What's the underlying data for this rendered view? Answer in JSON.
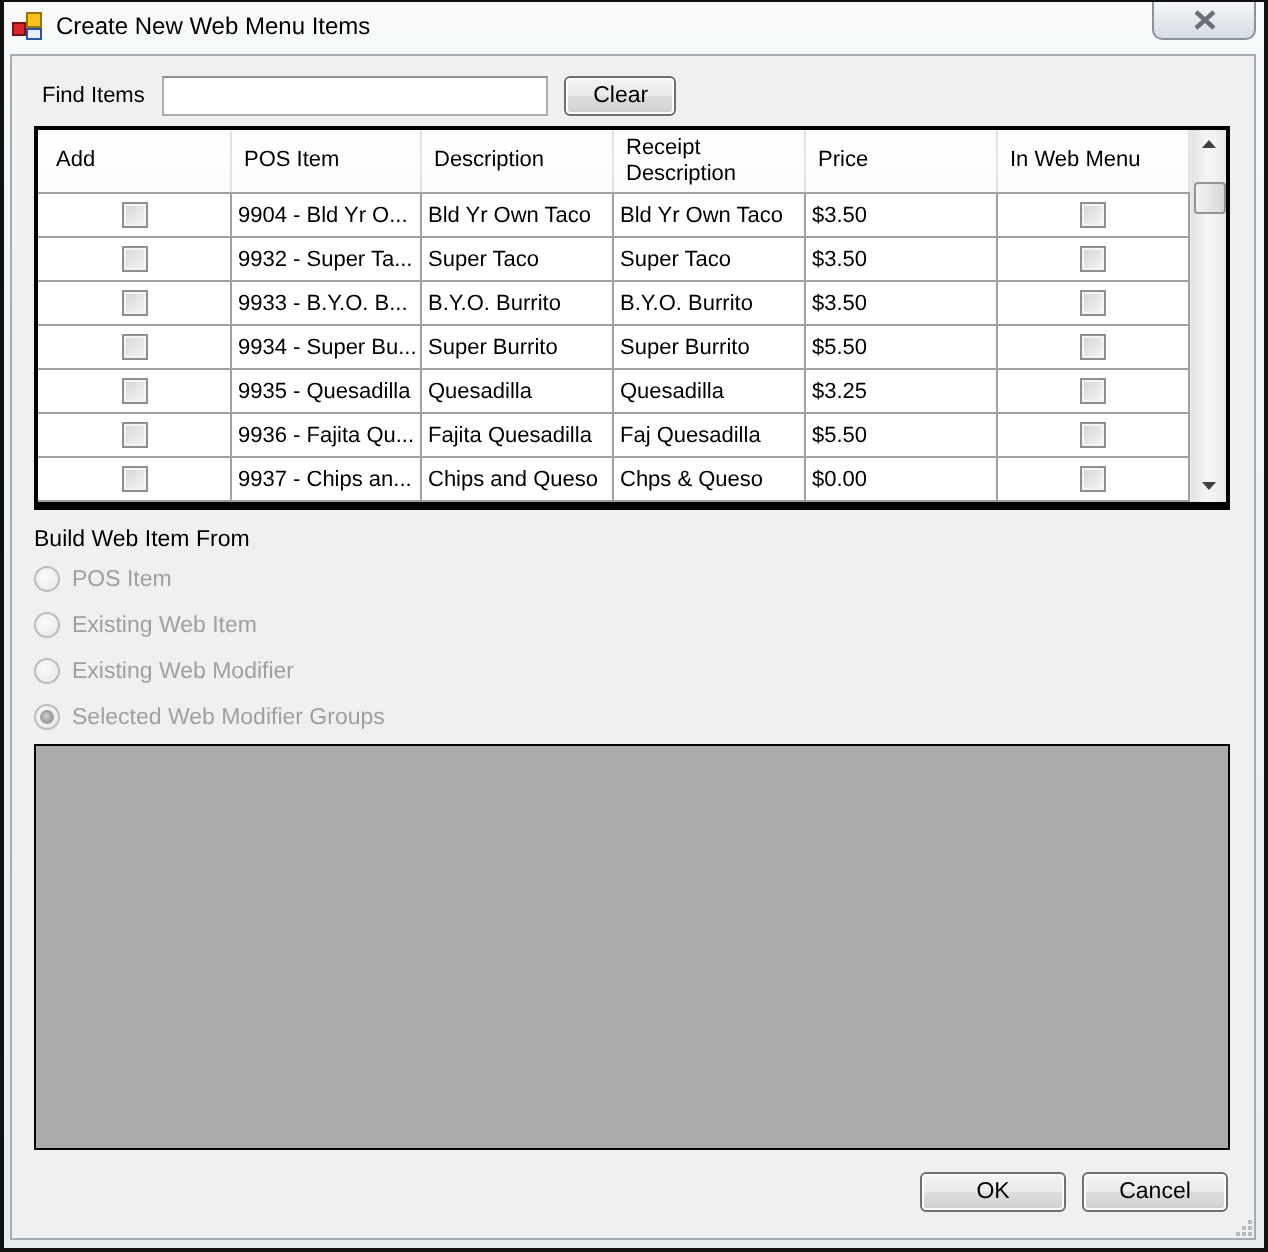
{
  "window": {
    "title": "Create New Web Menu Items"
  },
  "search": {
    "label": "Find Items",
    "button": "Clear"
  },
  "grid": {
    "columns": [
      "Add",
      "POS Item",
      "Description",
      "Receipt Description",
      "Price",
      "In Web Menu"
    ],
    "rows": [
      {
        "add": false,
        "pos_item": "9904 - Bld Yr O...",
        "description": "Bld Yr Own Taco",
        "receipt_description": "Bld Yr Own Taco",
        "price": "$3.50",
        "in_web_menu": false
      },
      {
        "add": false,
        "pos_item": "9932 - Super Ta...",
        "description": "Super Taco",
        "receipt_description": "Super Taco",
        "price": "$3.50",
        "in_web_menu": false
      },
      {
        "add": false,
        "pos_item": "9933 - B.Y.O. B...",
        "description": "B.Y.O. Burrito",
        "receipt_description": "B.Y.O. Burrito",
        "price": "$3.50",
        "in_web_menu": false
      },
      {
        "add": false,
        "pos_item": "9934 - Super Bu...",
        "description": "Super Burrito",
        "receipt_description": "Super Burrito",
        "price": "$5.50",
        "in_web_menu": false
      },
      {
        "add": false,
        "pos_item": "9935 - Quesadilla",
        "description": "Quesadilla",
        "receipt_description": "Quesadilla",
        "price": "$3.25",
        "in_web_menu": false
      },
      {
        "add": false,
        "pos_item": "9936 - Fajita Qu...",
        "description": "Fajita Quesadilla",
        "receipt_description": "Faj Quesadilla",
        "price": "$5.50",
        "in_web_menu": false
      },
      {
        "add": false,
        "pos_item": "9937 - Chips an...",
        "description": "Chips and Queso",
        "receipt_description": "Chps & Queso",
        "price": "$0.00",
        "in_web_menu": false
      }
    ]
  },
  "build_from": {
    "label": "Build Web Item From",
    "options": [
      {
        "label": "POS Item",
        "selected": false,
        "disabled": true
      },
      {
        "label": "Existing Web Item",
        "selected": false,
        "disabled": true
      },
      {
        "label": "Existing Web Modifier",
        "selected": false,
        "disabled": true
      },
      {
        "label": "Selected Web Modifier Groups",
        "selected": true,
        "disabled": true
      }
    ]
  },
  "buttons": [
    "OK",
    "Cancel"
  ]
}
